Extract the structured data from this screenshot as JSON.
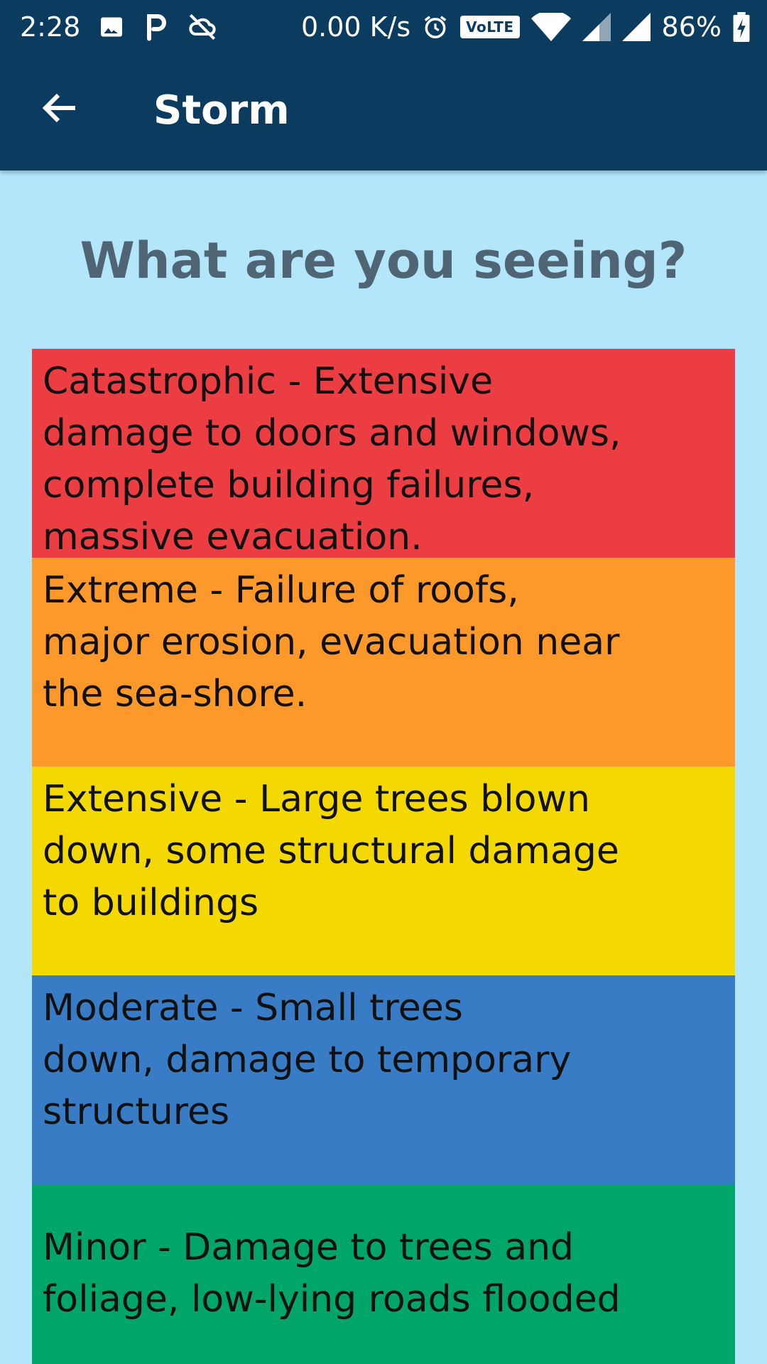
{
  "status_bar": {
    "time": "2:28",
    "network_speed": "0.00 K/s",
    "volte": "VoLTE",
    "battery": "86%",
    "icons": [
      "image-icon",
      "parking-icon",
      "cloud-off-icon",
      "alarm-icon",
      "wifi-icon",
      "signal-icon",
      "signal-icon",
      "battery-charging-icon"
    ]
  },
  "app_bar": {
    "title": "Storm",
    "back_icon": "arrow-back-icon"
  },
  "heading": "What are you seeing?",
  "options": [
    {
      "label": " Catastrophic - Extensive\ndamage to doors and windows,\ncomplete building failures,\nmassive evacuation.",
      "color": "#ec3d43"
    },
    {
      "label": " Extreme - Failure of roofs,\nmajor erosion, evacuation near\nthe sea-shore.",
      "color": "#fd982b"
    },
    {
      "label": " Extensive - Large trees blown\ndown, some structural damage\nto buildings",
      "color": "#f4d801"
    },
    {
      "label": " Moderate - Small trees\ndown, damage to temporary\nstructures",
      "color": "#387cc5"
    },
    {
      "label": " Minor - Damage to trees and\nfoliage, low-lying roads flooded",
      "color": "#00a56a"
    }
  ],
  "colors": {
    "app_bar": "#0b3c5f",
    "background": "#b3e5fb",
    "heading": "#4f6573"
  }
}
